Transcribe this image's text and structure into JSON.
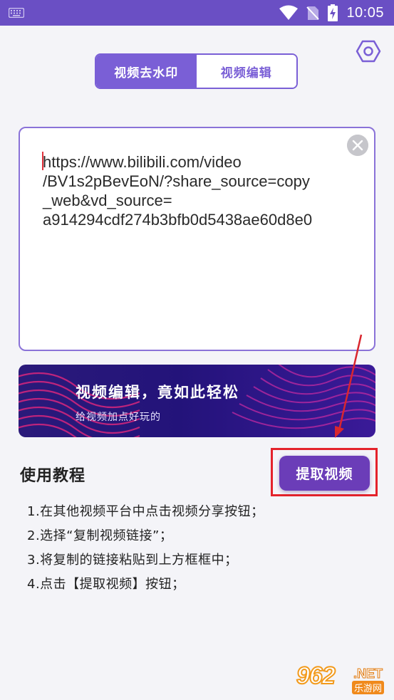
{
  "status_bar": {
    "time": "10:05"
  },
  "tabs": [
    {
      "label": "视频去水印",
      "active": true
    },
    {
      "label": "视频编辑",
      "active": false
    }
  ],
  "url_input": {
    "value": "https://www.bilibili.com/video\n/BV1s2pBevEoN/?share_source=copy\n_web&vd_source=\na914294cdf274b3bfb0d5438ae60d8e0"
  },
  "banner": {
    "title": "视频编辑，竟如此轻松",
    "subtitle": "给视频加点好玩的"
  },
  "tutorial": {
    "title": "使用教程",
    "steps": [
      "1.在其他视频平台中点击视频分享按钮；",
      "2.选择“复制视频链接”；",
      "3.将复制的链接粘贴到上方框框中；",
      "4.点击【提取视频】按钮；"
    ]
  },
  "extract_button": {
    "label": "提取视频"
  },
  "watermark": {
    "number": "962",
    "net": ".NET",
    "site": "乐游网"
  },
  "colors": {
    "primary": "#7a5fd6",
    "status_bar": "#6a4fc4",
    "button": "#6b3db8",
    "highlight": "#e4232b"
  }
}
